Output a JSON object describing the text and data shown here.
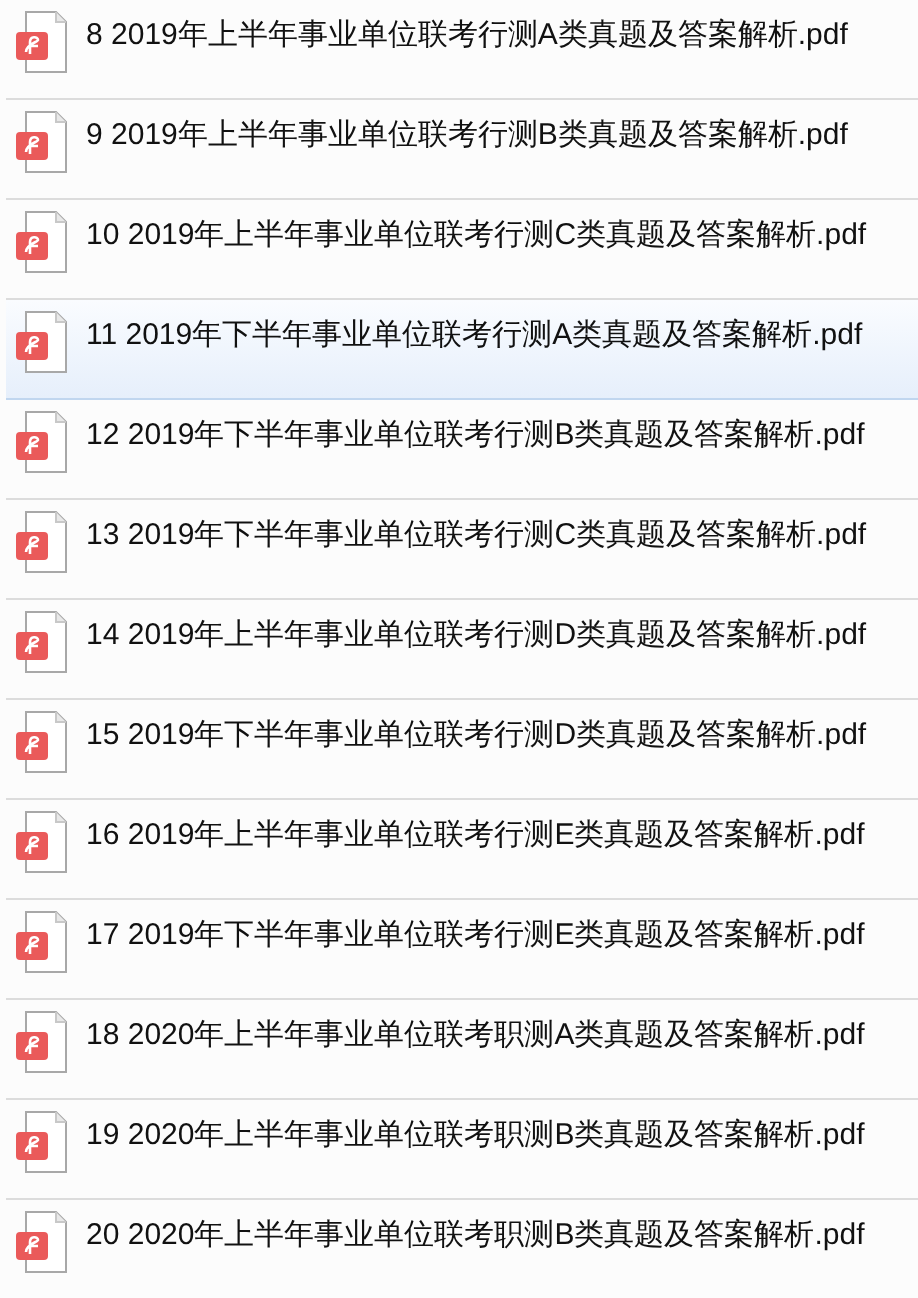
{
  "files": [
    {
      "name": "8 2019年上半年事业单位联考行测A类真题及答案解析.pdf",
      "selected": false
    },
    {
      "name": "9 2019年上半年事业单位联考行测B类真题及答案解析.pdf",
      "selected": false
    },
    {
      "name": "10 2019年上半年事业单位联考行测C类真题及答案解析.pdf",
      "selected": false
    },
    {
      "name": "11 2019年下半年事业单位联考行测A类真题及答案解析.pdf",
      "selected": true
    },
    {
      "name": "12 2019年下半年事业单位联考行测B类真题及答案解析.pdf",
      "selected": false
    },
    {
      "name": "13 2019年下半年事业单位联考行测C类真题及答案解析.pdf",
      "selected": false
    },
    {
      "name": "14 2019年上半年事业单位联考行测D类真题及答案解析.pdf",
      "selected": false
    },
    {
      "name": "15 2019年下半年事业单位联考行测D类真题及答案解析.pdf",
      "selected": false
    },
    {
      "name": "16 2019年上半年事业单位联考行测E类真题及答案解析.pdf",
      "selected": false
    },
    {
      "name": "17 2019年下半年事业单位联考行测E类真题及答案解析.pdf",
      "selected": false
    },
    {
      "name": "18 2020年上半年事业单位联考职测A类真题及答案解析.pdf",
      "selected": false
    },
    {
      "name": "19 2020年上半年事业单位联考职测B类真题及答案解析.pdf",
      "selected": false
    },
    {
      "name": "20 2020年上半年事业单位联考职测B类真题及答案解析.pdf",
      "selected": false
    }
  ]
}
